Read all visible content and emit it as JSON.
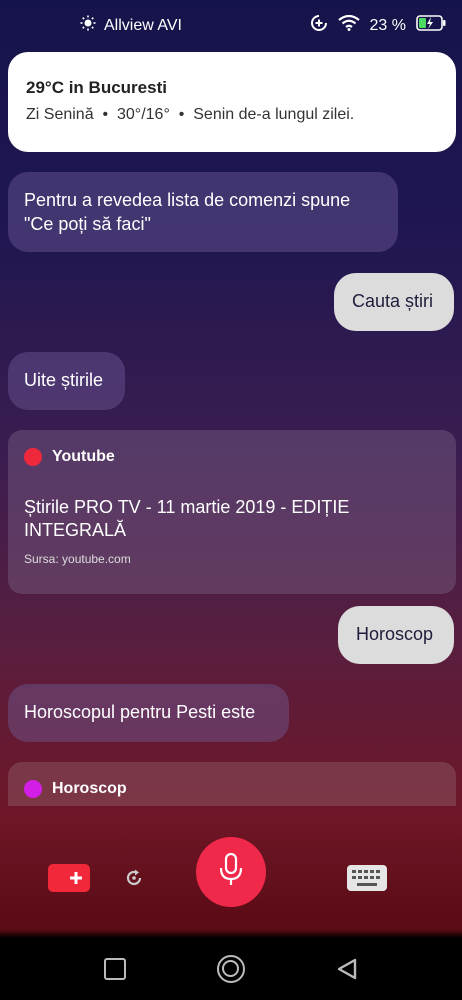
{
  "status": {
    "carrier": "Allview AVI",
    "battery": "23 %"
  },
  "weather": {
    "title": "29°C in Bucuresti",
    "summary": "Zi Senină",
    "range": "30°/16°",
    "detail": "Senin de-a lungul zilei."
  },
  "messages": {
    "intro": "Pentru a revedea lista de comenzi spune \"Ce poți să faci\"",
    "user1": "Cauta știri",
    "bot1": "Uite știrile",
    "user2": "Horoscop",
    "bot2": "Horoscopul pentru Pesti este"
  },
  "news_card": {
    "source": "Youtube",
    "source_color": "#f0283c",
    "title": "Știrile PRO TV - 11 martie 2019 - EDIȚIE INTEGRALĂ",
    "sursa": "Sursa: youtube.com"
  },
  "horoscope_card": {
    "source": "Horoscop",
    "source_color": "#d21ee6"
  },
  "toolbar": {
    "mic_color": "#f0284a",
    "youtube_icon": "youtube-add-icon",
    "refresh_icon": "refresh-icon",
    "keyboard_icon": "keyboard-icon"
  }
}
